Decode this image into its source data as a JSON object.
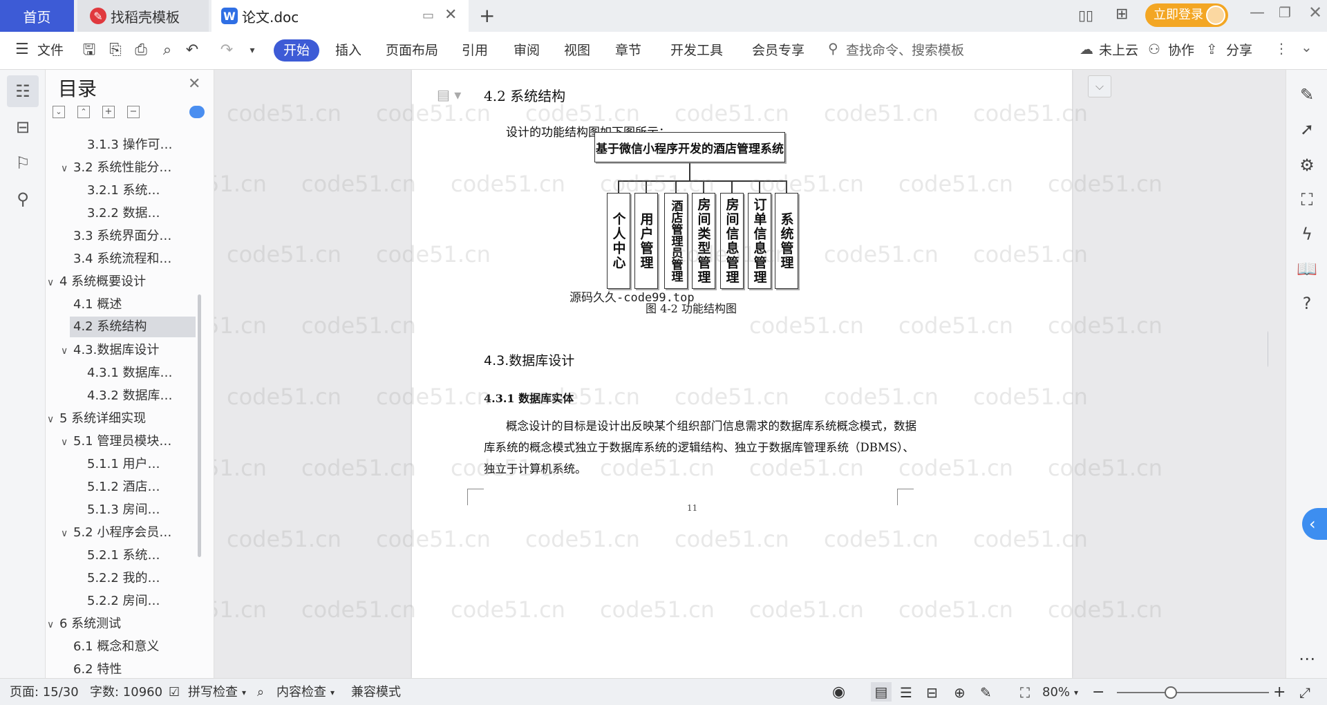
{
  "tabs": {
    "home": "首页",
    "daoke": "找稻壳模板",
    "doc": "论文.doc",
    "login_button": "立即登录"
  },
  "toolbar": {
    "file": "文件",
    "menus": [
      "开始",
      "插入",
      "页面布局",
      "引用",
      "审阅",
      "视图",
      "章节",
      "开发工具",
      "会员专享"
    ],
    "search_placeholder": "查找命令、搜索模板",
    "cloud": "未上云",
    "collab": "协作",
    "share": "分享"
  },
  "toc": {
    "title": "目录",
    "items": [
      {
        "text": "3.1.3 操作可…",
        "level": 3
      },
      {
        "text": "3.2 系统性能分…",
        "level": 2,
        "expanded": true
      },
      {
        "text": "3.2.1  系统…",
        "level": 3
      },
      {
        "text": "3.2.2  数据…",
        "level": 3
      },
      {
        "text": "3.3 系统界面分…",
        "level": 2
      },
      {
        "text": "3.4 系统流程和…",
        "level": 2
      },
      {
        "text": "4 系统概要设计",
        "level": 1,
        "expanded": true
      },
      {
        "text": "4.1 概述",
        "level": 2
      },
      {
        "text": "4.2 系统结构",
        "level": 2,
        "selected": true
      },
      {
        "text": "4.3.数据库设计",
        "level": 2,
        "expanded": true
      },
      {
        "text": "4.3.1 数据库…",
        "level": 3
      },
      {
        "text": "4.3.2 数据库…",
        "level": 3
      },
      {
        "text": "5 系统详细实现",
        "level": 1,
        "expanded": true
      },
      {
        "text": "5.1  管理员模块…",
        "level": 2,
        "expanded": true
      },
      {
        "text": "5.1.1  用户…",
        "level": 3
      },
      {
        "text": "5.1.2  酒店…",
        "level": 3
      },
      {
        "text": "5.1.3  房间…",
        "level": 3
      },
      {
        "text": "5.2  小程序会员…",
        "level": 2,
        "expanded": true
      },
      {
        "text": "5.2.1  系统…",
        "level": 3
      },
      {
        "text": "5.2.2  我的…",
        "level": 3
      },
      {
        "text": "5.2.2  房间…",
        "level": 3
      },
      {
        "text": "6 系统测试",
        "level": 1,
        "expanded": true
      },
      {
        "text": "6.1 概念和意义",
        "level": 2
      },
      {
        "text": "6.2 特性",
        "level": 2
      }
    ]
  },
  "document": {
    "heading_42": "4.2 系统结构",
    "intro": "设计的功能结构图如下图所示：",
    "chart_root": "基于微信小程序开发的酒店管理系统",
    "chart_children": [
      "个人中心",
      "用户管理",
      "酒店管理员管理",
      "房间类型管理",
      "房间信息管理",
      "订单信息管理",
      "系统管理"
    ],
    "overlay_text": "源码久久-code99.top",
    "caption": "图 4-2 功能结构图",
    "heading_43": "4.3.数据库设计",
    "heading_431": "4.3.1 数据库实体",
    "para_line1": "概念设计的目标是设计出反映某个组织部门信息需求的数据库系统概念模式，数据",
    "para_line2": "库系统的概念模式独立于数据库系统的逻辑结构、独立于数据库管理系统（DBMS）、",
    "para_line3": "独立于计算机系统。",
    "page_number": "11",
    "watermark": "code51.cn"
  },
  "status": {
    "page": "页面: 15/30",
    "words": "字数: 10960",
    "spell": "拼写检查",
    "content_check": "内容检查",
    "compat": "兼容模式",
    "zoom": "80%"
  }
}
